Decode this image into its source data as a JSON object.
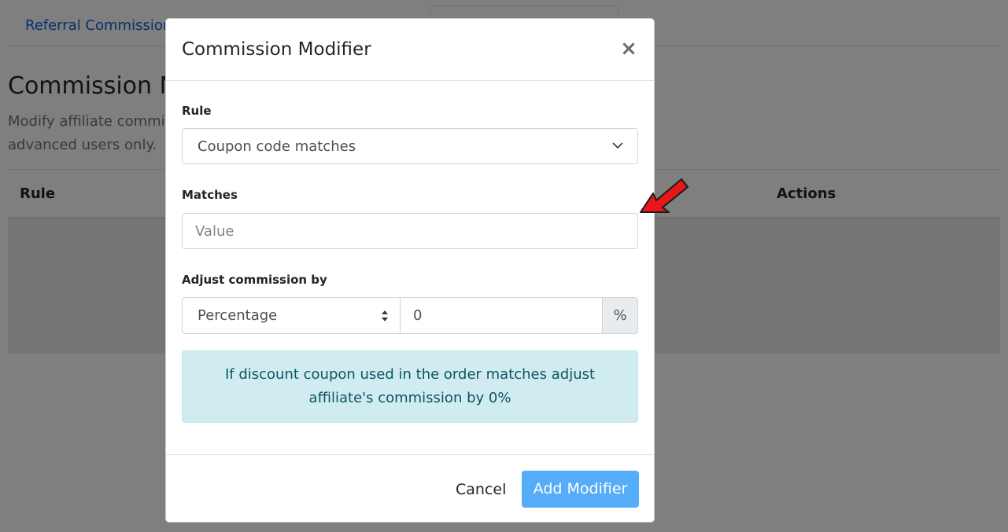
{
  "background": {
    "tab_label": "Referral Commission",
    "section_title": "Commission Modifiers",
    "description_line1": "Modify affiliate commission",
    "description_line2": "advanced users only.",
    "table_headers": {
      "rule": "Rule",
      "actions": "Actions"
    }
  },
  "modal": {
    "title": "Commission Modifier",
    "close_symbol": "×",
    "rule_label": "Rule",
    "rule_selected": "Coupon code matches",
    "matches_label": "Matches",
    "matches_placeholder": "Value",
    "adjust_label": "Adjust commission by",
    "adjust_type_selected": "Percentage",
    "adjust_value": "0",
    "adjust_unit": "%",
    "summary_line1": "If discount coupon used in the order matches adjust",
    "summary_line2": "affiliate's commission by 0%",
    "cancel_label": "Cancel",
    "add_label": "Add Modifier"
  },
  "colors": {
    "link": "#0b62d6",
    "primary_button": "#55acf9",
    "info_bg": "#d1ecf1",
    "info_text": "#0c5460",
    "annotation_arrow": "#e8151b"
  },
  "icons": {
    "close": "close-icon",
    "select_caret": "chevron-down-icon",
    "select_updown": "updown-icon",
    "annotation": "arrow-pointer-icon"
  }
}
